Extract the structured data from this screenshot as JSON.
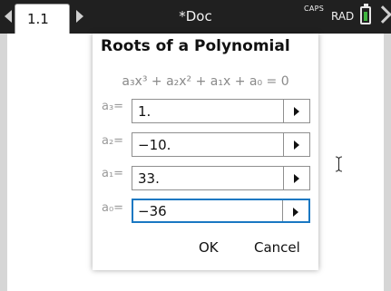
{
  "topbar": {
    "tab_label": "1.1",
    "doc_title": "*Doc",
    "caps": "CAPS",
    "angle_mode": "RAD",
    "battery_level": 0.85
  },
  "dialog": {
    "title": "Roots of a Polynomial",
    "equation": "a₃x³ + a₂x² + a₁x + a₀ = 0",
    "fields": [
      {
        "label": "a₃=",
        "value": "1."
      },
      {
        "label": "a₂=",
        "value": "−10."
      },
      {
        "label": "a₁=",
        "value": "33."
      },
      {
        "label": "a₀=",
        "value": "−36"
      }
    ],
    "ok_label": "OK",
    "cancel_label": "Cancel"
  },
  "colors": {
    "focus": "#1a78c2",
    "battery": "#3fb53f"
  }
}
